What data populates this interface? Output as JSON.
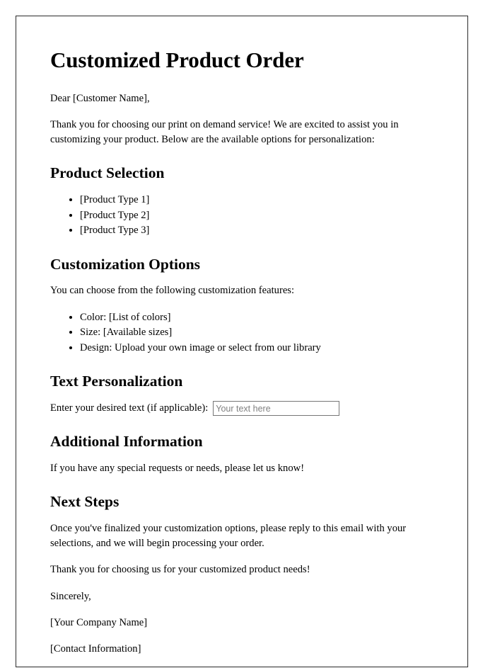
{
  "document": {
    "title": "Customized Product Order",
    "salutation": "Dear [Customer Name],",
    "intro": "Thank you for choosing our print on demand service! We are excited to assist you in customizing your product. Below are the available options for personalization:"
  },
  "product_selection": {
    "heading": "Product Selection",
    "items": [
      "[Product Type 1]",
      "[Product Type 2]",
      "[Product Type 3]"
    ]
  },
  "customization_options": {
    "heading": "Customization Options",
    "lead": "You can choose from the following customization features:",
    "items": [
      "Color: [List of colors]",
      "Size: [Available sizes]",
      "Design: Upload your own image or select from our library"
    ]
  },
  "text_personalization": {
    "heading": "Text Personalization",
    "label": "Enter your desired text (if applicable):",
    "input_value": "",
    "input_placeholder": "Your text here"
  },
  "additional_information": {
    "heading": "Additional Information",
    "body": "If you have any special requests or needs, please let us know!"
  },
  "next_steps": {
    "heading": "Next Steps",
    "body": "Once you've finalized your customization options, please reply to this email with your selections, and we will begin processing your order.",
    "thanks": "Thank you for choosing us for your customized product needs!"
  },
  "signature": {
    "closing": "Sincerely,",
    "company": "[Your Company Name]",
    "contact": "[Contact Information]"
  },
  "colors": {
    "page_border": "#2b2b2b",
    "text": "#000000",
    "input_border": "#767676",
    "placeholder": "#808080",
    "background": "#ffffff"
  }
}
